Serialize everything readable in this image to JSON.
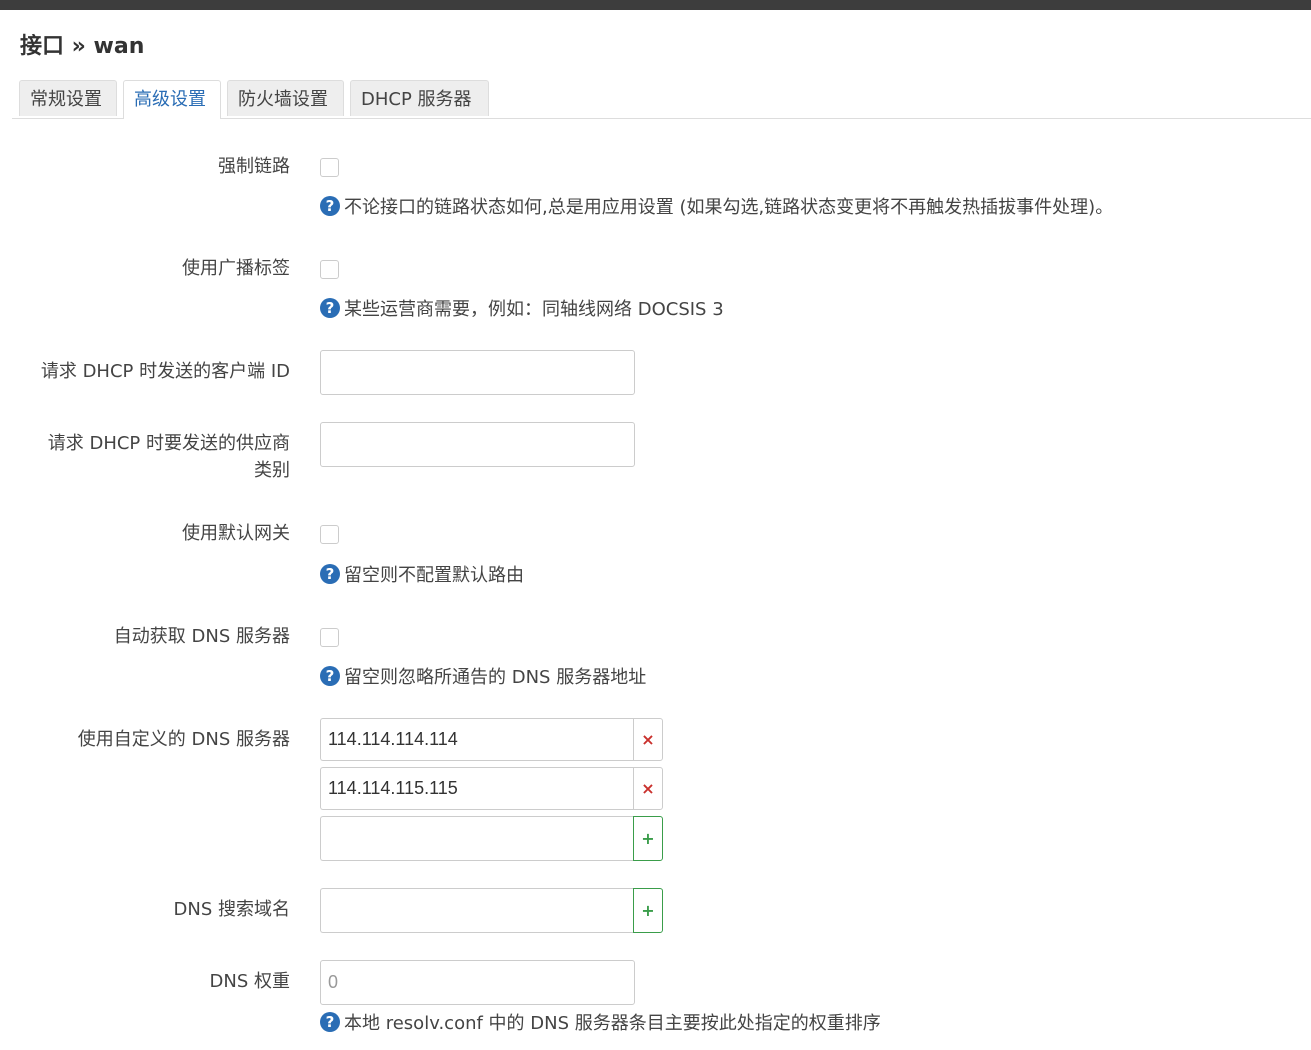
{
  "page": {
    "title": "接口 » wan"
  },
  "tabs": [
    {
      "label": "常规设置"
    },
    {
      "label": "高级设置"
    },
    {
      "label": "防火墙设置"
    },
    {
      "label": "DHCP 服务器"
    }
  ],
  "active_tab": "高级设置",
  "fields": {
    "force_link": {
      "label": "强制链路",
      "checked": false,
      "help": "不论接口的链路状态如何,总是用应用设置 (如果勾选,链路状态变更将不再触发热插拔事件处理)。"
    },
    "broadcast_flag": {
      "label": "使用广播标签",
      "checked": false,
      "help": "某些运营商需要，例如：同轴线网络 DOCSIS 3"
    },
    "client_id": {
      "label": "请求 DHCP 时发送的客户端 ID",
      "value": ""
    },
    "vendor_class": {
      "label_line1": "请求 DHCP 时要发送的供应商",
      "label_line2": "类别",
      "value": ""
    },
    "default_gateway": {
      "label": "使用默认网关",
      "checked": false,
      "help": "留空则不配置默认路由"
    },
    "peer_dns": {
      "label": "自动获取 DNS 服务器",
      "checked": false,
      "help": "留空则忽略所通告的 DNS 服务器地址"
    },
    "custom_dns": {
      "label": "使用自定义的 DNS 服务器",
      "entries": [
        "114.114.114.114",
        "114.114.115.115"
      ],
      "new_entry": "",
      "remove_symbol": "×",
      "add_symbol": "+"
    },
    "dns_search": {
      "label": "DNS 搜索域名",
      "value": "",
      "add_symbol": "+"
    },
    "dns_weight": {
      "label": "DNS 权重",
      "placeholder": "0",
      "help": "本地 resolv.conf 中的 DNS 服务器条目主要按此处指定的权重排序"
    }
  },
  "icons": {
    "help": "question-circle-icon",
    "help_glyph": "?"
  },
  "colors": {
    "accent": "#2a6db5",
    "remove": "#c9302c",
    "add": "#3a9d4a"
  }
}
